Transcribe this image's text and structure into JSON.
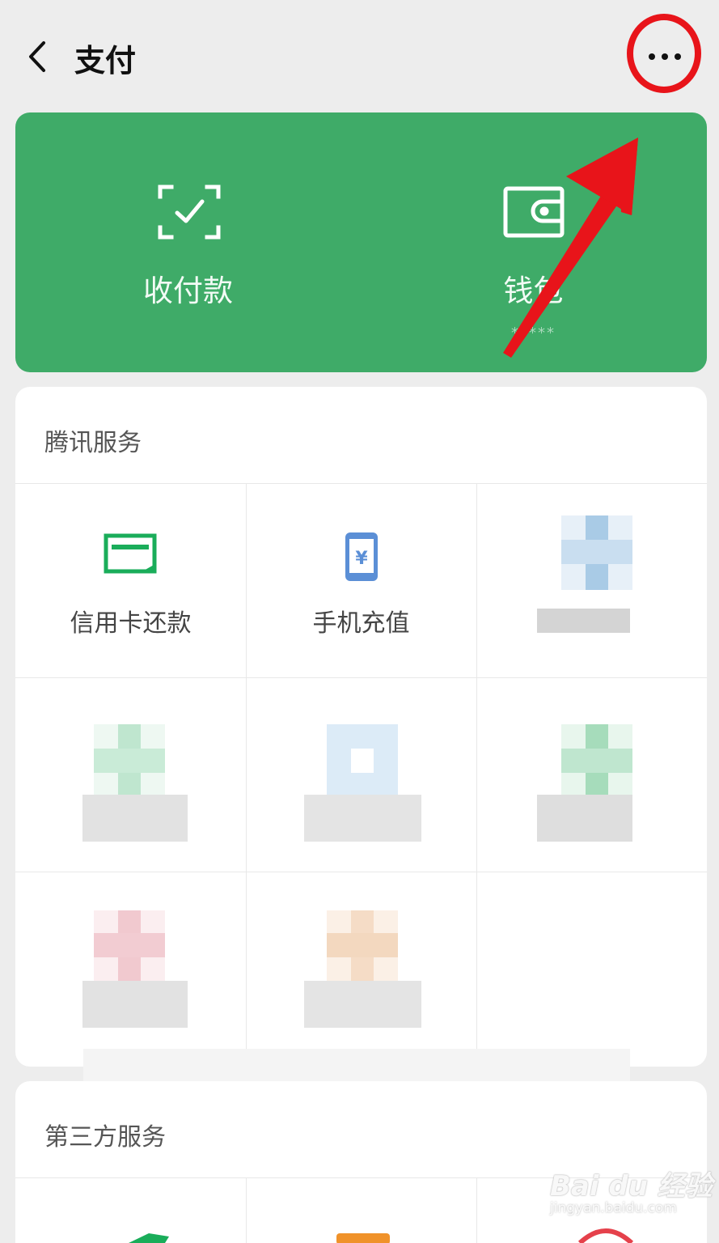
{
  "header": {
    "title": "支付",
    "back_icon": "chevron-left-icon",
    "more_icon": "more-dots-icon"
  },
  "wallet_card": {
    "color": "#3fab68",
    "items": [
      {
        "label": "收付款",
        "icon": "scan-check-icon"
      },
      {
        "label": "钱包",
        "icon": "wallet-icon",
        "sub": "*****"
      }
    ]
  },
  "tencent_services": {
    "title": "腾讯服务",
    "items": [
      {
        "label": "信用卡还款",
        "icon": "credit-card-icon"
      },
      {
        "label": "手机充值",
        "icon": "phone-yuan-icon"
      }
    ]
  },
  "third_party_services": {
    "title": "第三方服务"
  },
  "annotation": {
    "highlight_color": "#e8141a"
  },
  "watermark": {
    "main": "Bai du 经验",
    "sub": "jingyan.baidu.com"
  }
}
